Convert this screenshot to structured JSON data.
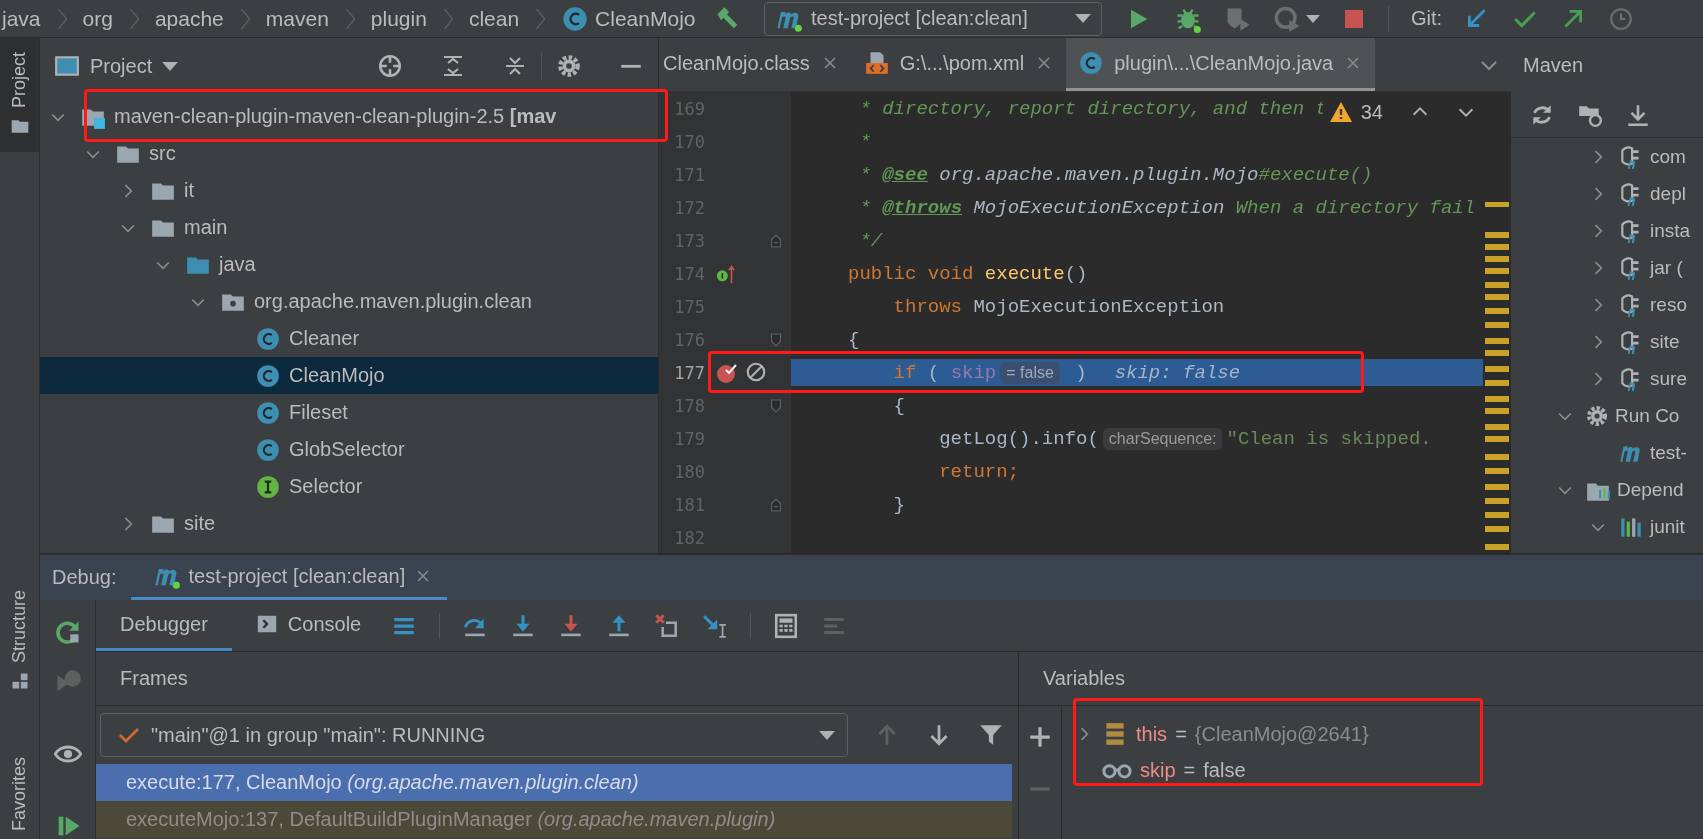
{
  "breadcrumb": [
    {
      "label": "java",
      "kind": "package"
    },
    {
      "label": "org",
      "kind": "package"
    },
    {
      "label": "apache",
      "kind": "package"
    },
    {
      "label": "maven",
      "kind": "package"
    },
    {
      "label": "plugin",
      "kind": "package"
    },
    {
      "label": "clean",
      "kind": "package"
    },
    {
      "label": "CleanMojo",
      "kind": "class"
    }
  ],
  "run_config": {
    "label": "test-project [clean:clean]"
  },
  "git": {
    "label": "Git:"
  },
  "tool_stripe": {
    "top": [
      {
        "label": "Project",
        "selected": true
      }
    ],
    "bottom": [
      {
        "label": "Structure",
        "selected": false
      },
      {
        "label": "Favorites",
        "selected": false
      }
    ]
  },
  "project": {
    "title": "Project",
    "tree": [
      {
        "label": "maven-clean-plugin-maven-clean-plugin-2.5 **[mav**",
        "kind": "module",
        "expanded": true,
        "selected": false,
        "children": [
          {
            "label": "src",
            "kind": "folder",
            "expanded": true,
            "selected": false,
            "children": [
              {
                "label": "it",
                "kind": "folder",
                "expanded": false,
                "selected": false
              },
              {
                "label": "main",
                "kind": "folder",
                "expanded": true,
                "selected": false,
                "children": [
                  {
                    "label": "java",
                    "kind": "source",
                    "expanded": true,
                    "selected": false,
                    "children": [
                      {
                        "label": "org.apache.maven.plugin.clean",
                        "kind": "package",
                        "expanded": true,
                        "selected": false,
                        "children": [
                          {
                            "label": "Cleaner",
                            "kind": "class",
                            "selected": false
                          },
                          {
                            "label": "CleanMojo",
                            "kind": "class",
                            "selected": true
                          },
                          {
                            "label": "Fileset",
                            "kind": "class",
                            "selected": false
                          },
                          {
                            "label": "GlobSelector",
                            "kind": "class",
                            "selected": false
                          },
                          {
                            "label": "Selector",
                            "kind": "interface",
                            "selected": false
                          }
                        ]
                      }
                    ]
                  }
                ]
              },
              {
                "label": "site",
                "kind": "folder",
                "expanded": false,
                "selected": false
              }
            ]
          }
        ]
      }
    ]
  },
  "editor": {
    "tabs": [
      {
        "label": "CleanMojo.class",
        "kind": "class-file",
        "selected": false
      },
      {
        "label": "G:\\...\\pom.xml",
        "kind": "xml",
        "selected": false
      },
      {
        "label": "plugin\\...\\CleanMojo.java",
        "kind": "java",
        "selected": true
      }
    ],
    "warning_count": "34",
    "lines": [
      {
        "number": "169",
        "tokens": [
          {
            "text": " * directory, report directory, and then t",
            "kind": "comment"
          }
        ]
      },
      {
        "number": "170",
        "tokens": [
          {
            "text": " *",
            "kind": "comment"
          }
        ]
      },
      {
        "number": "171",
        "tokens": [
          {
            "text": " * ",
            "kind": "comment"
          },
          {
            "text": "@see",
            "kind": "doc-tag"
          },
          {
            "text": " org.apache.maven.plugin.Mojo",
            "kind": "doc-ref"
          },
          {
            "text": "#execute()",
            "kind": "comment"
          }
        ]
      },
      {
        "number": "172",
        "tokens": [
          {
            "text": " * ",
            "kind": "comment"
          },
          {
            "text": "@throws",
            "kind": "doc-tag"
          },
          {
            "text": " MojoExecutionException",
            "kind": "doc-ref"
          },
          {
            "text": " When a directory fail",
            "kind": "comment"
          }
        ]
      },
      {
        "number": "173",
        "fold_end": true,
        "tokens": [
          {
            "text": " */",
            "kind": "comment"
          }
        ]
      },
      {
        "number": "174",
        "implements": true,
        "tokens": [
          {
            "text": "public void ",
            "kind": "keyword"
          },
          {
            "text": "execute",
            "kind": "method"
          },
          {
            "text": "()",
            "kind": "plain"
          }
        ]
      },
      {
        "number": "175",
        "tokens": [
          {
            "text": "    throws",
            "kind": "keyword"
          },
          {
            "text": " MojoExecutionException",
            "kind": "plain"
          }
        ]
      },
      {
        "number": "176",
        "fold_start": true,
        "tokens": [
          {
            "text": "{",
            "kind": "plain"
          }
        ]
      },
      {
        "number": "177",
        "breakpoint": true,
        "current": true,
        "tokens": [
          {
            "text": "    if",
            "kind": "keyword"
          },
          {
            "text": " ( ",
            "kind": "plain"
          },
          {
            "text": "skip",
            "kind": "field"
          },
          {
            "text": "= false",
            "kind": "inline-value"
          },
          {
            "text": " )",
            "kind": "plain"
          },
          {
            "text": "skip: false",
            "kind": "debug-value"
          }
        ]
      },
      {
        "number": "178",
        "fold_start": true,
        "tokens": [
          {
            "text": "    {",
            "kind": "plain"
          }
        ]
      },
      {
        "number": "179",
        "tokens": [
          {
            "text": "        getLog().info(",
            "kind": "plain"
          },
          {
            "text": "charSequence:",
            "kind": "hint"
          },
          {
            "text": "\"Clean is skipped.",
            "kind": "string"
          }
        ]
      },
      {
        "number": "180",
        "tokens": [
          {
            "text": "        return;",
            "kind": "keyword"
          }
        ]
      },
      {
        "number": "181",
        "fold_end": true,
        "tokens": [
          {
            "text": "    }",
            "kind": "plain"
          }
        ]
      },
      {
        "number": "182"
      }
    ]
  },
  "maven": {
    "title": "Maven",
    "tree": [
      {
        "label": "com",
        "kind": "plugin",
        "expanded": false,
        "selected": false
      },
      {
        "label": "depl",
        "kind": "plugin",
        "expanded": false,
        "selected": false
      },
      {
        "label": "insta",
        "kind": "plugin",
        "expanded": false,
        "selected": false
      },
      {
        "label": "jar (",
        "kind": "plugin",
        "expanded": false,
        "selected": false
      },
      {
        "label": "reso",
        "kind": "plugin",
        "expanded": false,
        "selected": false
      },
      {
        "label": "site",
        "kind": "plugin",
        "expanded": false,
        "selected": false
      },
      {
        "label": "sure",
        "kind": "plugin",
        "expanded": false,
        "selected": false
      },
      {
        "label": "Run Co",
        "kind": "run-configs",
        "expanded": true,
        "selected": false,
        "children": [
          {
            "label": "test-",
            "kind": "run-config",
            "selected": false
          }
        ]
      },
      {
        "label": "Depend",
        "kind": "dependencies",
        "expanded": true,
        "selected": false,
        "children": [
          {
            "label": "junit",
            "kind": "library",
            "expanded": true,
            "selected": false
          }
        ]
      }
    ]
  },
  "debug": {
    "label": "Debug:",
    "sessions": [
      {
        "label": "test-project [clean:clean]",
        "selected": true
      }
    ],
    "tabs": [
      {
        "label": "Debugger",
        "kind": "debugger",
        "selected": true
      },
      {
        "label": "Console",
        "kind": "console",
        "selected": false
      }
    ],
    "frames": {
      "title": "Frames",
      "thread": "\"main\"@1 in group \"main\": RUNNING",
      "rows": [
        {
          "text": "execute:177, CleanMojo *(org.apache.maven.plugin.clean)*",
          "kind": "project",
          "selected": true
        },
        {
          "text": "executeMojo:137, DefaultBuildPluginManager *(org.apache.maven.plugin)*",
          "kind": "library",
          "selected": false
        }
      ]
    },
    "variables": {
      "title": "Variables",
      "rows": [
        {
          "name": "this",
          "operator": "=",
          "value": "{CleanMojo@2641}",
          "kind": "object",
          "expanded": false,
          "selected": false
        },
        {
          "name": "skip",
          "operator": "=",
          "value": "false",
          "kind": "watch",
          "selected": false
        }
      ]
    }
  }
}
